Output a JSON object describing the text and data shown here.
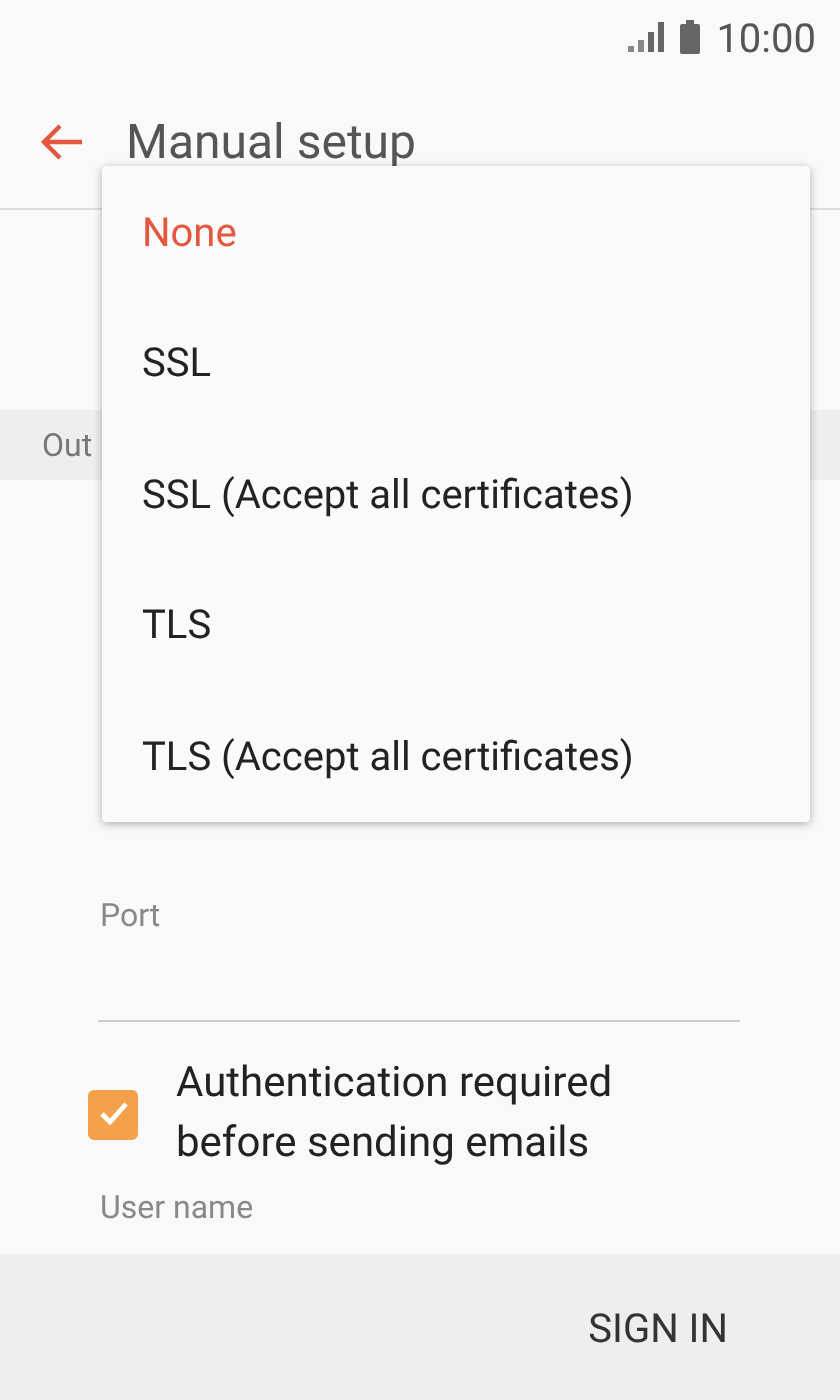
{
  "status_bar": {
    "time": "10:00"
  },
  "header": {
    "title": "Manual setup"
  },
  "section": {
    "title": "Out"
  },
  "port": {
    "label": "Port"
  },
  "auth": {
    "label": "Authentication required before sending emails",
    "checked": true
  },
  "username": {
    "label": "User name"
  },
  "security_menu": {
    "options": [
      {
        "label": "None",
        "selected": true
      },
      {
        "label": "SSL",
        "selected": false
      },
      {
        "label": "SSL (Accept all certificates)",
        "selected": false
      },
      {
        "label": "TLS",
        "selected": false
      },
      {
        "label": "TLS (Accept all certificates)",
        "selected": false
      }
    ]
  },
  "footer": {
    "button": "SIGN IN"
  }
}
